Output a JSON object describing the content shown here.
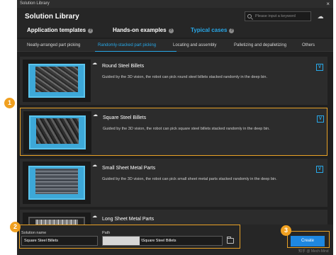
{
  "window": {
    "title": "Solution Library",
    "close": "×"
  },
  "header": {
    "title": "Solution Library",
    "search_placeholder": "Please input a keyword"
  },
  "tabs": [
    {
      "label": "Application templates",
      "active": false
    },
    {
      "label": "Hands-on examples",
      "active": false
    },
    {
      "label": "Typical cases",
      "active": true
    }
  ],
  "subtabs": [
    {
      "label": "Neatly-arranged part picking",
      "active": false
    },
    {
      "label": "Randomly-stacked part picking",
      "active": true
    },
    {
      "label": "Locating and assembly",
      "active": false
    },
    {
      "label": "Palletizing and depalletizing",
      "active": false
    },
    {
      "label": "Others",
      "active": false
    }
  ],
  "cards": [
    {
      "title": "Round Steel Billets",
      "description": "Guided by the 3D vision, the robot can pick round steel billets stacked randomly in the deep bin.",
      "selected": false
    },
    {
      "title": "Square Steel Billets",
      "description": "Guided by the 3D vision, the robot can pick square steel billets stacked randomly in the deep bin.",
      "selected": true
    },
    {
      "title": "Small Sheet Metal Parts",
      "description": "Guided by the 3D vision, the robot can pick small sheet metal parts stacked randomly in the deep bin.",
      "selected": false
    },
    {
      "title": "Long Sheet Metal Parts",
      "description": "",
      "selected": false
    }
  ],
  "footer": {
    "name_label": "Solution name",
    "name_value": "Square Steel Billets",
    "path_label": "Path",
    "path_value": "\\Square Steel Billets",
    "create_label": "Create"
  },
  "callouts": [
    "1",
    "2",
    "3"
  ],
  "watermark": "知乎 @ Mech-Mind",
  "colors": {
    "accent": "#28a8e8",
    "highlight": "#e8a126",
    "badge": "#f0a020",
    "create": "#1e87e0"
  }
}
